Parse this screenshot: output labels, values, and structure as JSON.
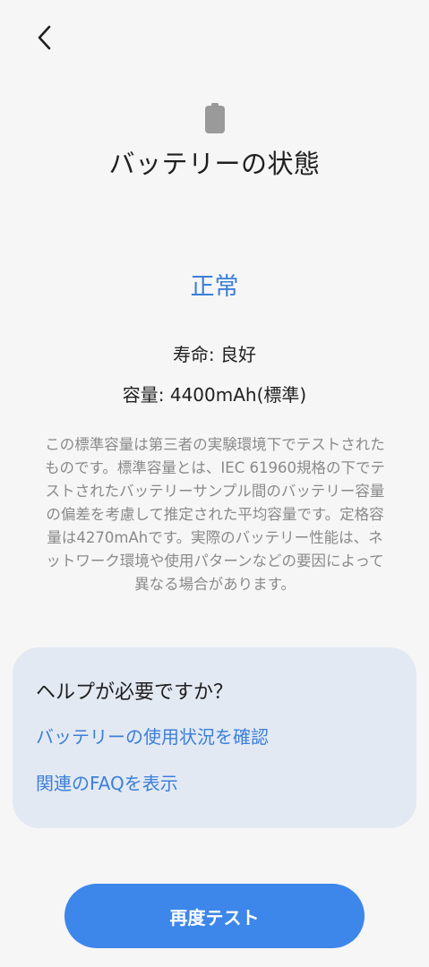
{
  "header": {
    "back_icon": "chevron-left-icon",
    "battery_icon": "battery-icon",
    "title": "バッテリーの状態"
  },
  "status": {
    "label": "正常",
    "color": "#3c7fd9"
  },
  "details": {
    "life": "寿命: 良好",
    "capacity": "容量: 4400mAh(標準)"
  },
  "description": "この標準容量は第三者の実験環境下でテストされたものです。標準容量とは、IEC 61960規格の下でテストされたバッテリーサンプル間のバッテリー容量の偏差を考慮して推定された平均容量です。定格容量は4270mAhです。実際のバッテリー性能は、ネットワーク環境や使用パターンなどの要因によって異なる場合があります。",
  "help": {
    "title": "ヘルプが必要ですか？",
    "links": [
      "バッテリーの使用状況を確認",
      "関連のFAQを表示"
    ]
  },
  "action": {
    "retest_label": "再度テスト",
    "color": "#3d86ea"
  }
}
